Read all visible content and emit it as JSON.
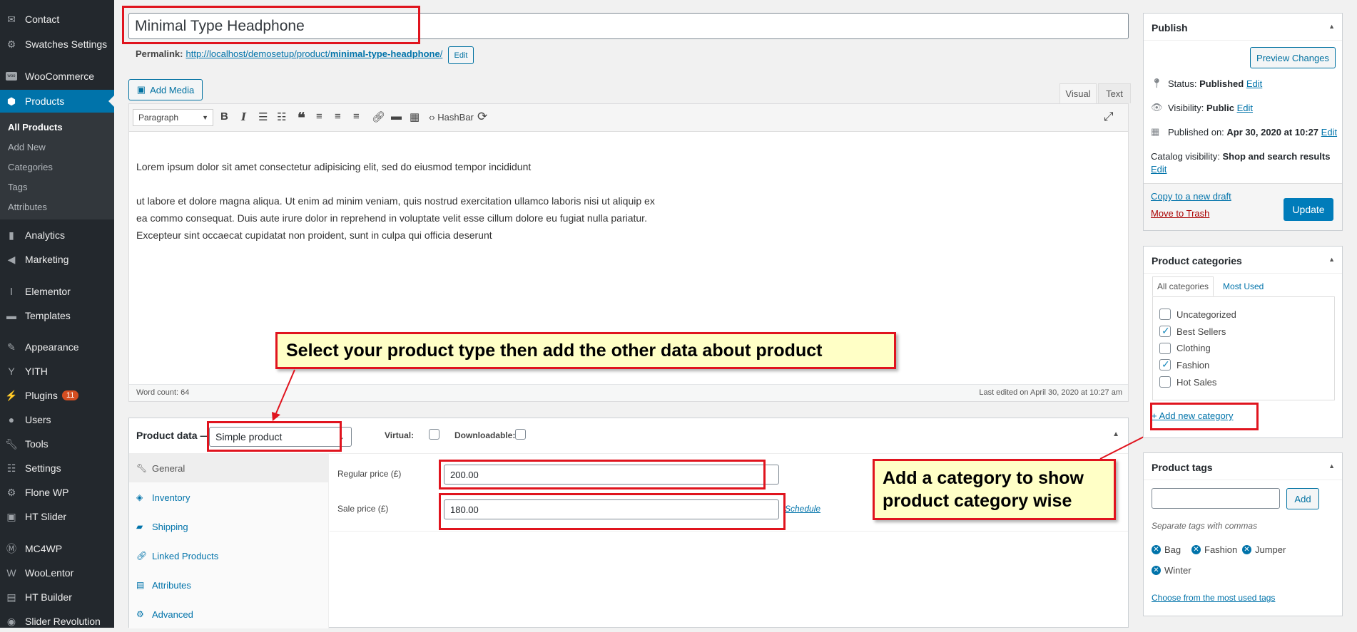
{
  "sidebar": {
    "items": [
      {
        "label": "Contact",
        "icon": "mail-icon"
      },
      {
        "label": "Swatches Settings",
        "icon": "gear-icon"
      },
      {
        "label": "WooCommerce",
        "icon": "woo-icon"
      },
      {
        "label": "Products",
        "icon": "box-icon"
      },
      {
        "label": "Analytics",
        "icon": "chart-icon"
      },
      {
        "label": "Marketing",
        "icon": "megaphone-icon"
      },
      {
        "label": "Elementor",
        "icon": "elementor-icon"
      },
      {
        "label": "Templates",
        "icon": "folder-icon"
      },
      {
        "label": "Appearance",
        "icon": "brush-icon"
      },
      {
        "label": "YITH",
        "icon": "yith-icon"
      },
      {
        "label": "Plugins",
        "icon": "plug-icon",
        "badge": "11"
      },
      {
        "label": "Users",
        "icon": "user-icon"
      },
      {
        "label": "Tools",
        "icon": "wrench-icon"
      },
      {
        "label": "Settings",
        "icon": "sliders-icon"
      },
      {
        "label": "Flone WP",
        "icon": "gear-icon"
      },
      {
        "label": "HT Slider",
        "icon": "slider-icon"
      },
      {
        "label": "MC4WP",
        "icon": "mc4wp-icon"
      },
      {
        "label": "WooLentor",
        "icon": "woolentor-icon"
      },
      {
        "label": "HT Builder",
        "icon": "builder-icon"
      },
      {
        "label": "Slider Revolution",
        "icon": "revolution-icon"
      }
    ],
    "submenu": [
      "All Products",
      "Add New",
      "Categories",
      "Tags",
      "Attributes"
    ]
  },
  "editor": {
    "title": "Minimal Type Headphone",
    "permalink_label": "Permalink:",
    "permalink_base": "http://localhost/demosetup/product/",
    "permalink_slug": "minimal-type-headphone",
    "permalink_end": "/",
    "edit_btn": "Edit",
    "add_media": "Add Media",
    "tab_visual": "Visual",
    "tab_text": "Text",
    "format": "Paragraph",
    "hashbar": "HashBar",
    "content_p1": "Lorem ipsum dolor sit amet consectetur adipisicing elit, sed do eiusmod tempor incididunt",
    "content_p2a": "ut labore et dolore magna aliqua. Ut enim ad minim veniam, quis nostrud exercitation ullamco laboris nisi ut aliquip ex",
    "content_p2b": "ea commo consequat. Duis aute irure dolor in reprehend in voluptate velit esse cillum dolore eu fugiat nulla pariatur.",
    "content_p2c": "Excepteur sint occaecat cupidatat non proident, sunt in culpa qui officia deserunt",
    "word_count": "Word count: 64",
    "last_edited": "Last edited on April 30, 2020 at 10:27 am"
  },
  "callouts": {
    "product_type": "Select your product type then add the other data about product",
    "category_l1": "Add a category to show",
    "category_l2": "product category wise"
  },
  "product_data": {
    "title": "Product data —",
    "type": "Simple product",
    "virtual": "Virtual:",
    "downloadable": "Downloadable:",
    "tabs": [
      "General",
      "Inventory",
      "Shipping",
      "Linked Products",
      "Attributes",
      "Advanced"
    ],
    "regular_label": "Regular price (£)",
    "regular_value": "200.00",
    "sale_label": "Sale price (£)",
    "sale_value": "180.00",
    "schedule": "Schedule"
  },
  "publish": {
    "title": "Publish",
    "preview": "Preview Changes",
    "status_label": "Status:",
    "status_value": "Published",
    "visibility_label": "Visibility:",
    "visibility_value": "Public",
    "published_label": "Published on:",
    "published_value": "Apr 30, 2020 at 10:27",
    "catalog_label": "Catalog visibility:",
    "catalog_value": "Shop and search results",
    "edit": "Edit",
    "copy_draft": "Copy to a new draft",
    "trash": "Move to Trash",
    "update": "Update"
  },
  "categories": {
    "title": "Product categories",
    "tab_all": "All categories",
    "tab_used": "Most Used",
    "items": [
      {
        "label": "Uncategorized",
        "checked": false
      },
      {
        "label": "Best Sellers",
        "checked": true
      },
      {
        "label": "Clothing",
        "checked": false
      },
      {
        "label": "Fashion",
        "checked": true
      },
      {
        "label": "Hot Sales",
        "checked": false
      }
    ],
    "add_new": "+ Add new category"
  },
  "tags": {
    "title": "Product tags",
    "add": "Add",
    "hint": "Separate tags with commas",
    "items": [
      "Bag",
      "Fashion",
      "Jumper",
      "Winter"
    ],
    "choose": "Choose from the most used tags"
  }
}
